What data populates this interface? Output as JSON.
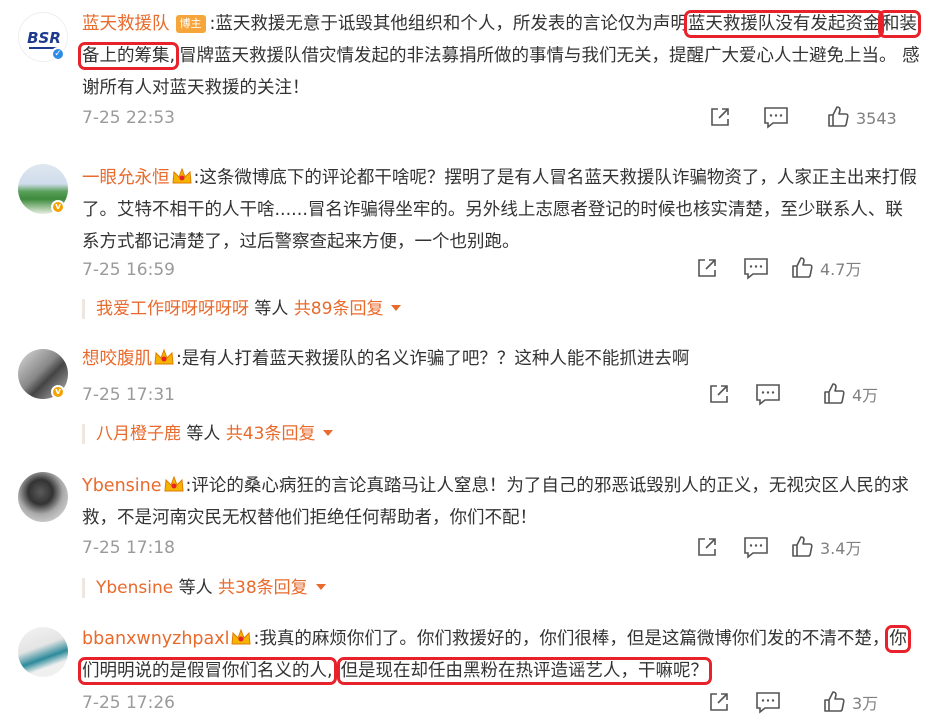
{
  "comments": [
    {
      "user": "蓝天救援队",
      "tag": "博主",
      "avatar_text": "BSR",
      "text_before": ":蓝天救援无意于诋毁其他组织和个人，所发表的言论仅为声明",
      "text_hl1": "蓝天救援队没有发起资金",
      "text_hl2": "和装备上的筹集,",
      "text_after": "冒牌蓝天救援队借灾情发起的非法募捐所做的事情与我们无关，提醒广大爱心人士避免上当。 感谢所有人对蓝天救援的关注！",
      "time": "7-25 22:53",
      "likes": "3543"
    },
    {
      "user": "一眼允永恒",
      "text": ":这条微博底下的评论都干啥呢？摆明了是有人冒名蓝天救援队诈骗物资了，人家正主出来打假了。艾特不相干的人干啥......冒名诈骗得坐牢的。另外线上志愿者登记的时候也核实清楚，至少联系人、联系方式都记清楚了，过后警察查起来方便，一个也别跑。",
      "time": "7-25 16:59",
      "likes": "4.7万",
      "replies": {
        "name": "我爱工作呀呀呀呀呀",
        "mid": " 等人 ",
        "count": "共89条回复"
      }
    },
    {
      "user": "想咬腹肌",
      "text": ":是有人打着蓝天救援队的名义诈骗了吧？？这种人能不能抓进去啊",
      "time": "7-25 17:31",
      "likes": "4万",
      "replies": {
        "name": "八月橙子鹿",
        "mid": " 等人 ",
        "count": "共43条回复"
      }
    },
    {
      "user": "Ybensine",
      "text": ":评论的桑心病狂的言论真踏马让人窒息！为了自己的邪恶诋毁别人的正义，无视灾区人民的求救，不是河南灾民无权替他们拒绝任何帮助者，你们不配！",
      "time": "7-25 17:18",
      "likes": "3.4万",
      "replies": {
        "name": "Ybensine",
        "mid": " 等人 ",
        "count": "共38条回复"
      }
    },
    {
      "user": "bbanxwnyzhpaxl",
      "text_before": ":我真的麻烦你们了。你们救援好的，你们很棒，但是这篇微博你们发的不清不楚，",
      "text_hl1": "你们明明说的是假冒你们名义的人,",
      "text_hl2": "但是现在却任由黑粉在热评造谣艺人，干嘛呢？",
      "time": "7-25 17:26",
      "likes": "3万"
    }
  ],
  "colors": {
    "username": "#e86a2c",
    "highlight": "#e8222a",
    "meta": "#9a9a9a"
  },
  "icons": [
    "share-icon",
    "comment-icon",
    "like-icon",
    "crown-icon",
    "verified-icon"
  ]
}
